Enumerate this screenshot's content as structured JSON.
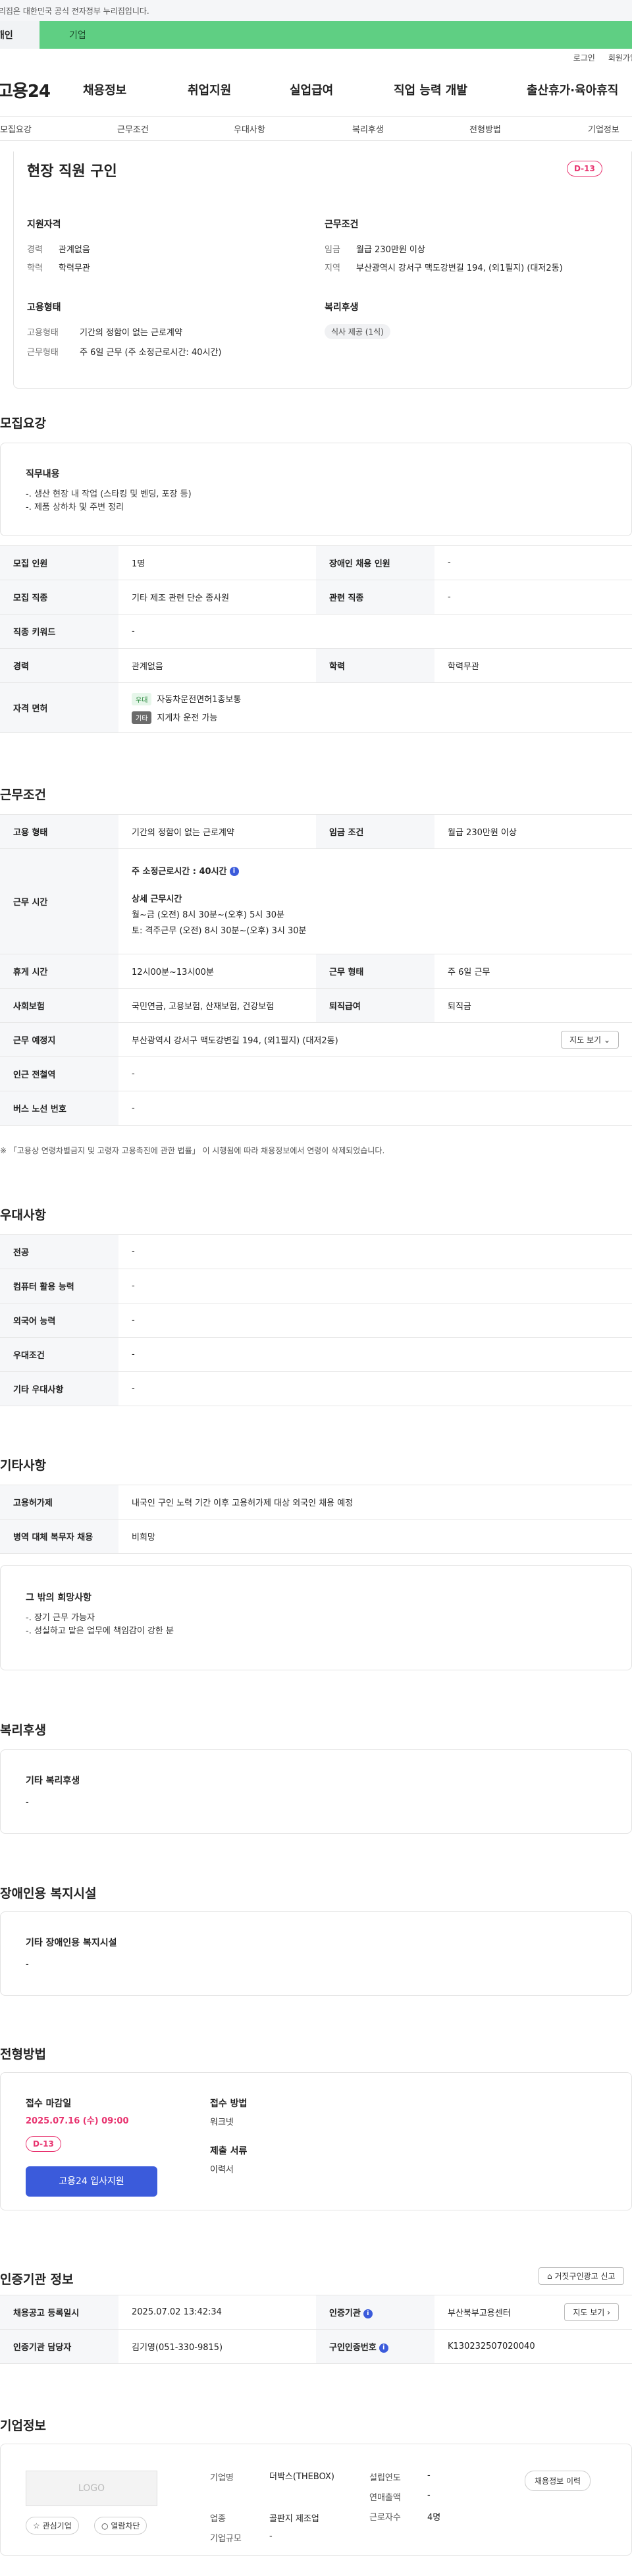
{
  "gov_notice": "이 누리집은 대한민국 공식 전자정부 누리집입니다.",
  "top_tabs": {
    "individual": "개인",
    "business": "기업"
  },
  "util": {
    "login": "로그인",
    "join": "회원가입"
  },
  "logo": "고용24",
  "gnb": [
    "채용정보",
    "취업지원",
    "실업급여",
    "직업 능력 개발",
    "출산휴가·육아휴직"
  ],
  "subnav": [
    "모집요강",
    "근무조건",
    "우대사항",
    "복리후생",
    "전형방법",
    "기업정보"
  ],
  "summary": {
    "title": "현장 직원 구인",
    "dday": "D-13",
    "qual_head": "지원자격",
    "qual": [
      {
        "k": "경력",
        "v": "관계없음"
      },
      {
        "k": "학력",
        "v": "학력무관"
      }
    ],
    "cond_head": "근무조건",
    "cond": [
      {
        "k": "임금",
        "v": "월급 230만원 이상"
      },
      {
        "k": "지역",
        "v": "부산광역시 강서구 맥도강변길 194, (외1필지) (대저2동)"
      }
    ],
    "emp_head": "고용형태",
    "emp": [
      {
        "k": "고용형태",
        "v": "기간의 정함이 없는 근로계약"
      },
      {
        "k": "근무형태",
        "v": "주 6일 근무 (주 소정근로시간: 40시간)"
      }
    ],
    "welfare_head": "복리후생",
    "welfare_chip": "식사 제공 (1식)"
  },
  "recruit": {
    "title": "모집요강",
    "duty_head": "직무내용",
    "duty_text": "-. 생산 현장 내 작업 (스타킹 및 벤딩, 포장 등)\n-. 제품 상하차 및 주변 정리",
    "rows": {
      "count_k": "모집 인원",
      "count_v": "1명",
      "disabled_k": "장애인 채용 인원",
      "disabled_v": "-",
      "job_k": "모집 직종",
      "job_v": "기타 제조 관련 단순 종사원",
      "rel_k": "관련 직종",
      "rel_v": "-",
      "kw_k": "직종 키워드",
      "kw_v": "-",
      "career_k": "경력",
      "career_v": "관계없음",
      "edu_k": "학력",
      "edu_v": "학력무관",
      "lic_k": "자격 면허",
      "lic1_badge": "우대",
      "lic1": "자동차운전면허1종보통",
      "lic2_badge": "기타",
      "lic2": "지게차 운전 가능"
    }
  },
  "work": {
    "title": "근무조건",
    "emp_k": "고용 형태",
    "emp_v": "기간의 정함이 없는 근로계약",
    "wage_k": "임금 조건",
    "wage_v": "월급 230만원 이상",
    "hours_k": "근무 시간",
    "hours_main": "주 소정근로시간 : 40시간",
    "hours_detail_head": "상세 근무시간",
    "hours_detail1": "월~금 (오전) 8시 30분~(오후) 5시 30분",
    "hours_detail2": "토: 격주근무 (오전) 8시 30분~(오후) 3시 30분",
    "break_k": "휴게 시간",
    "break_v": "12시00분~13시00분",
    "shift_k": "근무 형태",
    "shift_v": "주 6일 근무",
    "ins_k": "사회보험",
    "ins_v": "국민연금, 고용보험, 산재보험, 건강보험",
    "sev_k": "퇴직급여",
    "sev_v": "퇴직금",
    "place_k": "근무 예정지",
    "place_v": "부산광역시 강서구 맥도강변길 194, (외1필지) (대저2동)",
    "map_btn": "지도 보기",
    "subway_k": "인근 전철역",
    "subway_v": "-",
    "bus_k": "버스 노선 번호",
    "bus_v": "-",
    "footnote": "※ 「고용상 연령차별금지 및 고령자 고용촉진에 관한 법률」 이 시행됨에 따라 채용정보에서 연령이 삭제되었습니다."
  },
  "pref": {
    "title": "우대사항",
    "rows": [
      {
        "k": "전공",
        "v": "-"
      },
      {
        "k": "컴퓨터 활용 능력",
        "v": "-"
      },
      {
        "k": "외국어 능력",
        "v": "-"
      },
      {
        "k": "우대조건",
        "v": "-"
      },
      {
        "k": "기타 우대사항",
        "v": "-"
      }
    ]
  },
  "etc": {
    "title": "기타사항",
    "rows": [
      {
        "k": "고용허가제",
        "v": "내국인 구인 노력 기간 이후 고용허가제 대상 외국인 채용 예정"
      },
      {
        "k": "병역 대체 복무자 채용",
        "v": "비희망"
      }
    ],
    "wish_head": "그 밖의 희망사항",
    "wish_text": "-. 장기 근무 가능자\n-. 성실하고 맡은 업무에 책임감이 강한 분"
  },
  "welfare": {
    "title": "복리후생",
    "head": "기타 복리후생",
    "text": "-"
  },
  "disab": {
    "title": "장애인용 복지시설",
    "head": "기타 장애인용 복지시설",
    "text": "-"
  },
  "select": {
    "title": "전형방법",
    "deadline_head": "접수 마감일",
    "deadline": "2025.07.16 (수) 09:00",
    "dday": "D-13",
    "apply_btn": "고용24 입사지원",
    "method_head": "접수 방법",
    "method": "워크넷",
    "docs_head": "제출 서류",
    "docs": "이력서"
  },
  "cert": {
    "title": "인증기관 정보",
    "report_btn": "거짓구인광고 신고",
    "reg_k": "채용공고 등록일시",
    "reg_v": "2025.07.02 13:42:34",
    "org_k": "인증기관",
    "org_v": "부산북부고용센터",
    "route_btn": "지도 보기",
    "mgr_k": "인증기관 담당자",
    "mgr_v": "김기영(051-330-9815)",
    "no_k": "구인인증번호",
    "no_v": "K130232507020040"
  },
  "company": {
    "title": "기업정보",
    "logo": "LOGO",
    "fav_btn": "관심기업",
    "block_btn": "열람차단",
    "history_btn": "채용정보 이력",
    "name_k": "기업명",
    "name_v": "더박스(THEBOX)",
    "ind_k": "업종",
    "ind_v": "골판지 제조업",
    "size_k": "기업규모",
    "size_v": "-",
    "year_k": "설립연도",
    "year_v": "-",
    "sales_k": "연매출액",
    "sales_v": "-",
    "emp_k": "근로자수",
    "emp_v": "4명"
  },
  "colors": {
    "accent": "#3b5bdb",
    "dday": "#e8336f",
    "biz_tab": "#5fcf83"
  }
}
